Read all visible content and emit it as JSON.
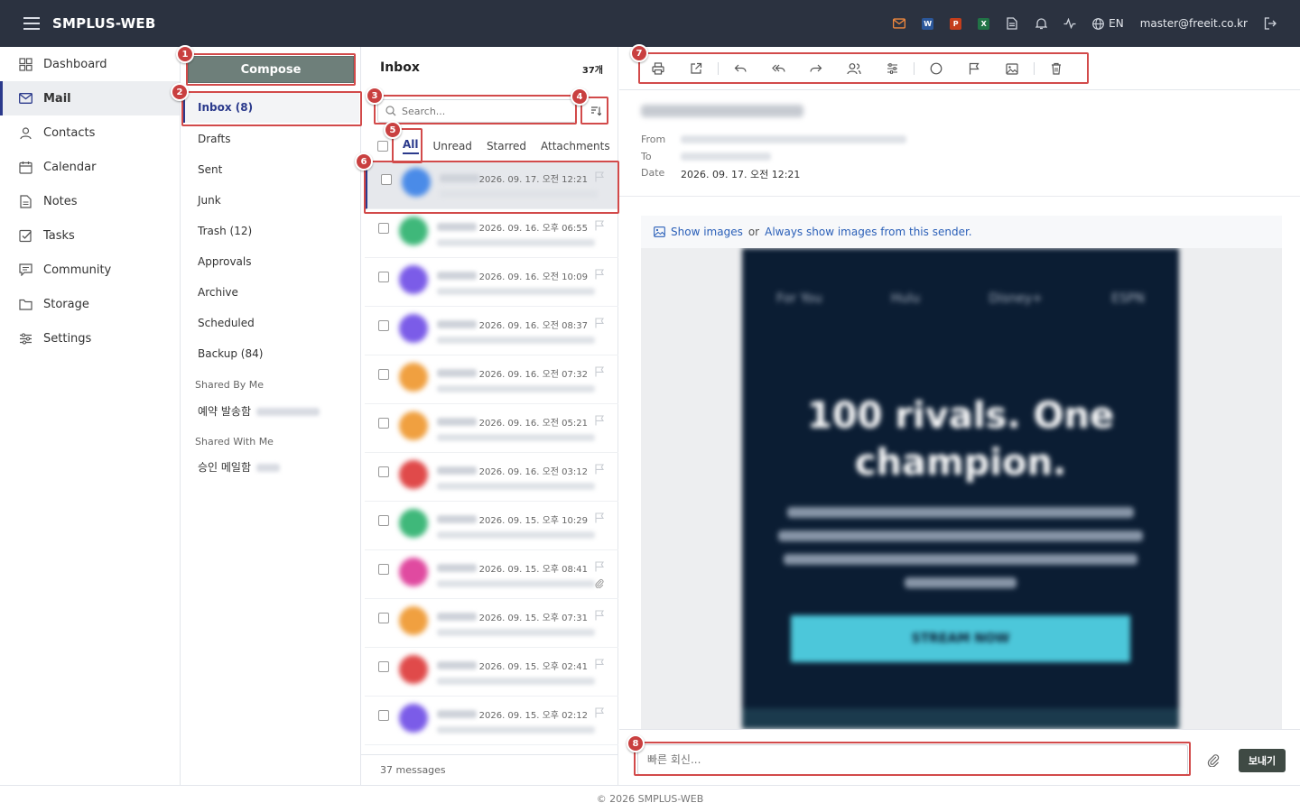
{
  "app": {
    "title": "SMPLUS-WEB",
    "footer": "© 2026 SMPLUS-WEB"
  },
  "topbar": {
    "icons": [
      "mail-icon",
      "word-icon",
      "powerpoint-icon",
      "excel-icon",
      "document-icon",
      "bell-icon",
      "activity-icon",
      "globe-icon",
      "logout-icon"
    ],
    "office_letters": {
      "word": "W",
      "powerpoint": "P",
      "excel": "X"
    },
    "office_colors": {
      "word": "#2b579a",
      "powerpoint": "#c43e1c",
      "excel": "#217346"
    },
    "mail_icon_color": "#f0883e",
    "language": "EN",
    "user_email": "master@freeit.co.kr"
  },
  "sidebar": {
    "items": [
      {
        "label": "Dashboard",
        "icon": "dashboard-icon"
      },
      {
        "label": "Mail",
        "icon": "mail-icon",
        "active": true
      },
      {
        "label": "Contacts",
        "icon": "contacts-icon"
      },
      {
        "label": "Calendar",
        "icon": "calendar-icon"
      },
      {
        "label": "Notes",
        "icon": "notes-icon"
      },
      {
        "label": "Tasks",
        "icon": "tasks-icon"
      },
      {
        "label": "Community",
        "icon": "community-icon"
      },
      {
        "label": "Storage",
        "icon": "folder-icon"
      },
      {
        "label": "Settings",
        "icon": "settings-icon"
      }
    ]
  },
  "folders": {
    "compose_label": "Compose",
    "items": [
      "Inbox (8)",
      "Drafts",
      "Sent",
      "Junk",
      "Trash (12)",
      "Approvals",
      "Archive",
      "Scheduled",
      "Backup (84)"
    ],
    "shared_by_me_label": "Shared By Me",
    "shared_by_me_item": "예약 발송함",
    "shared_with_me_label": "Shared With Me",
    "shared_with_me_item": "승인 메일함"
  },
  "list": {
    "title": "Inbox",
    "count": "37개",
    "search_placeholder": "Search...",
    "filters": [
      "All",
      "Unread",
      "Starred",
      "Attachments"
    ],
    "active_filter": "All",
    "footer": "37 messages",
    "emails": [
      {
        "date": "2026. 09. 17. 오전 12:21",
        "avatar_color": "#4a8be8",
        "selected": true,
        "attachment": false
      },
      {
        "date": "2026. 09. 16. 오후 06:55",
        "avatar_color": "#3fb87a",
        "selected": false,
        "attachment": false
      },
      {
        "date": "2026. 09. 16. 오전 10:09",
        "avatar_color": "#7b5ce8",
        "selected": false,
        "attachment": false
      },
      {
        "date": "2026. 09. 16. 오전 08:37",
        "avatar_color": "#7b5ce8",
        "selected": false,
        "attachment": false
      },
      {
        "date": "2026. 09. 16. 오전 07:32",
        "avatar_color": "#f0a040",
        "selected": false,
        "attachment": false
      },
      {
        "date": "2026. 09. 16. 오전 05:21",
        "avatar_color": "#f0a040",
        "selected": false,
        "attachment": false
      },
      {
        "date": "2026. 09. 16. 오전 03:12",
        "avatar_color": "#e04a4a",
        "selected": false,
        "attachment": false
      },
      {
        "date": "2026. 09. 15. 오후 10:29",
        "avatar_color": "#3fb87a",
        "selected": false,
        "attachment": false
      },
      {
        "date": "2026. 09. 15. 오후 08:41",
        "avatar_color": "#e04aa0",
        "selected": false,
        "attachment": true
      },
      {
        "date": "2026. 09. 15. 오후 07:31",
        "avatar_color": "#f0a040",
        "selected": false,
        "attachment": false
      },
      {
        "date": "2026. 09. 15. 오후 02:41",
        "avatar_color": "#e04a4a",
        "selected": false,
        "attachment": false
      },
      {
        "date": "2026. 09. 15. 오후 02:12",
        "avatar_color": "#7b5ce8",
        "selected": false,
        "attachment": false
      }
    ]
  },
  "reader": {
    "toolbar_icons": [
      "print-icon",
      "popout-icon",
      "reply-icon",
      "reply-all-icon",
      "forward-icon",
      "contacts-icon",
      "filter-settings-icon",
      "circle-icon",
      "flag-icon",
      "image-icon",
      "trash-icon"
    ],
    "from_label": "From",
    "to_label": "To",
    "date_label": "Date",
    "date_value": "2026. 09. 17. 오전 12:21",
    "images_bar": {
      "show": "Show images",
      "or": "or",
      "always": "Always show images from this sender."
    },
    "body": {
      "headline": "100 rivals. One champion.",
      "nav": [
        "For You",
        "Hulu",
        "Disney+",
        "ESPN"
      ],
      "cta": "STREAM NOW"
    },
    "reply_placeholder": "빠른 회신...",
    "send_label": "보내기"
  },
  "annotations": [
    "1",
    "2",
    "3",
    "4",
    "5",
    "6",
    "7",
    "8"
  ],
  "annotation_color": "#d24a4a"
}
